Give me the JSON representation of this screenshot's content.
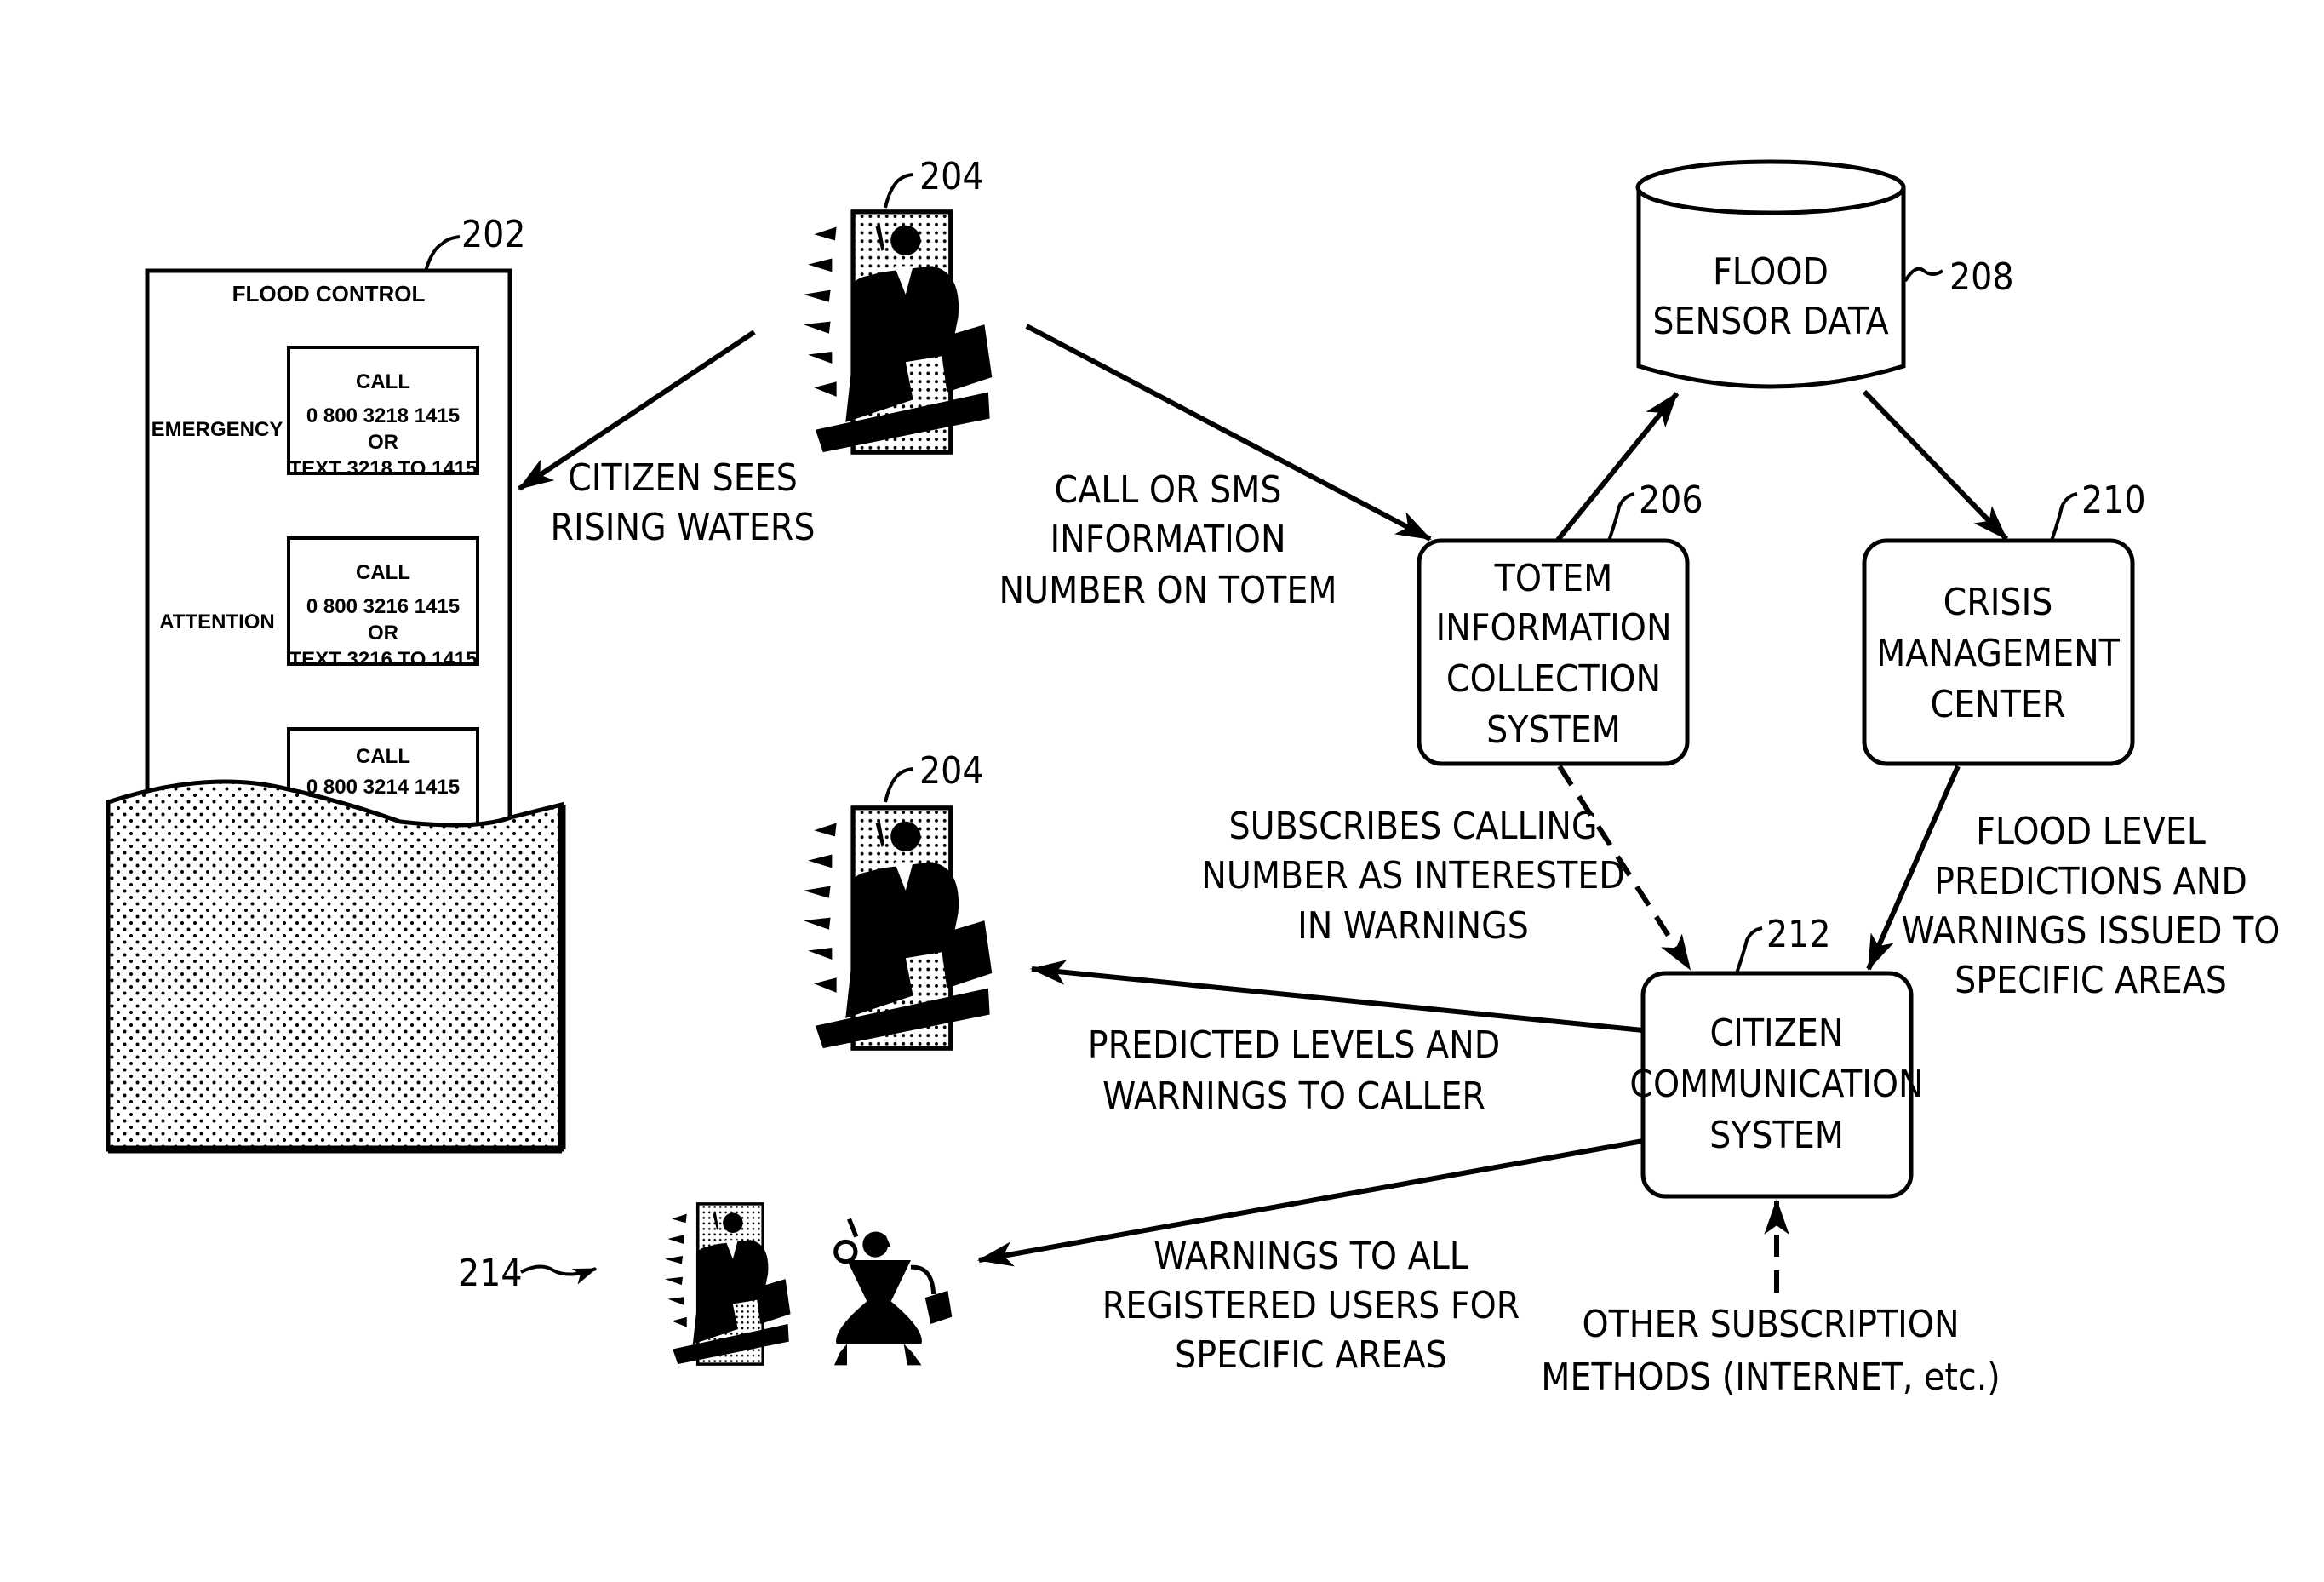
{
  "figure": {
    "sign": {
      "ref": "202",
      "title": "FLOOD CONTROL",
      "levels": [
        {
          "label": "EMERGENCY",
          "lines": [
            "CALL",
            "0 800 3218 1415",
            "OR",
            "TEXT 3218 TO 1415"
          ]
        },
        {
          "label": "ATTENTION",
          "lines": [
            "CALL",
            "0 800 3216 1415",
            "OR",
            "TEXT 3216 TO 1415"
          ]
        },
        {
          "label": "",
          "lines": [
            "CALL",
            "0 800 3214 1415"
          ]
        }
      ]
    },
    "citizen_top": {
      "ref": "204",
      "icon": "businessman-phone-icon"
    },
    "citizen_mid": {
      "ref": "204",
      "icon": "businessman-phone-icon"
    },
    "registered_users": {
      "ref": "214",
      "icons": [
        "businessman-phone-icon",
        "businesswoman-phone-icon"
      ]
    },
    "nodes": {
      "flood_sensor_data": {
        "ref": "208",
        "lines": [
          "FLOOD",
          "SENSOR DATA"
        ],
        "shape": "database-cylinder"
      },
      "totem_system": {
        "ref": "206",
        "lines": [
          "TOTEM",
          "INFORMATION",
          "COLLECTION",
          "SYSTEM"
        ]
      },
      "crisis_center": {
        "ref": "210",
        "lines": [
          "CRISIS",
          "MANAGEMENT",
          "CENTER"
        ]
      },
      "citizen_comm": {
        "ref": "212",
        "lines": [
          "CITIZEN",
          "COMMUNICATION",
          "SYSTEM"
        ]
      }
    },
    "edge_labels": {
      "sees_rising": [
        "CITIZEN SEES",
        "RISING WATERS"
      ],
      "call_sms": [
        "CALL OR SMS",
        "INFORMATION",
        "NUMBER ON TOTEM"
      ],
      "subscribes": [
        "SUBSCRIBES CALLING",
        "NUMBER AS INTERESTED",
        "IN WARNINGS"
      ],
      "flood_predictions": [
        "FLOOD LEVEL",
        "PREDICTIONS AND",
        "WARNINGS ISSUED TO",
        "SPECIFIC AREAS"
      ],
      "predicted_levels": [
        "PREDICTED LEVELS AND",
        "WARNINGS TO CALLER"
      ],
      "warnings_all": [
        "WARNINGS TO ALL",
        "REGISTERED USERS FOR",
        "SPECIFIC AREAS"
      ],
      "other_subscription": [
        "OTHER SUBSCRIPTION",
        "METHODS (INTERNET, etc.)"
      ]
    }
  }
}
